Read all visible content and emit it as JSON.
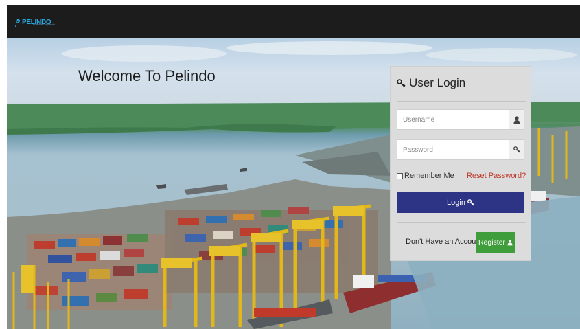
{
  "navbar": {
    "brand_name": "PELINDO",
    "brand_tagline": "subsidiary of pelindo"
  },
  "hero": {
    "welcome_text": "Welcome To Pelindo"
  },
  "login_panel": {
    "title": "User Login",
    "username_placeholder": "Username",
    "password_placeholder": "Password",
    "remember_label": "Remember Me",
    "remember_checked": false,
    "reset_link": "Reset Password?",
    "login_label": "Login",
    "no_account_text": "Don't Have an Account?",
    "register_label": "Register"
  },
  "colors": {
    "navbar_bg": "#1c1c1c",
    "brand": "#2aa8e0",
    "panel_bg": "#dcdcdc",
    "login_button": "#2d3486",
    "register_button": "#3f9d3c",
    "reset_link": "#c0392b"
  },
  "icons": {
    "title": "key-icon",
    "username_addon": "user-icon",
    "password_addon": "key-icon",
    "login_button": "key-icon",
    "register_button": "user-icon"
  }
}
